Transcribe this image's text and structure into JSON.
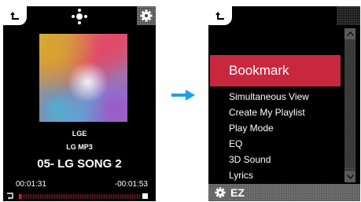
{
  "player": {
    "artist": "LGE",
    "album": "LG MP3",
    "song_title": "05- LG SONG 2",
    "time_elapsed": "00:01:31",
    "time_remaining": "-00:01:53",
    "progress_fraction": 0.02,
    "icons": {
      "back": "back-arrow-icon",
      "center": "dpad-icon",
      "settings": "gear-icon",
      "repeat": "repeat-icon"
    }
  },
  "transition": {
    "icon": "right-arrow-icon",
    "color": "#1ea0e6"
  },
  "menu": {
    "highlighted": "Bookmark",
    "items": [
      "Simultaneous View",
      "Create My Playlist",
      "Play Mode",
      "EQ",
      "3D Sound",
      "Lyrics"
    ],
    "footer_label": "EZ",
    "highlight_color": "#c8283e"
  }
}
